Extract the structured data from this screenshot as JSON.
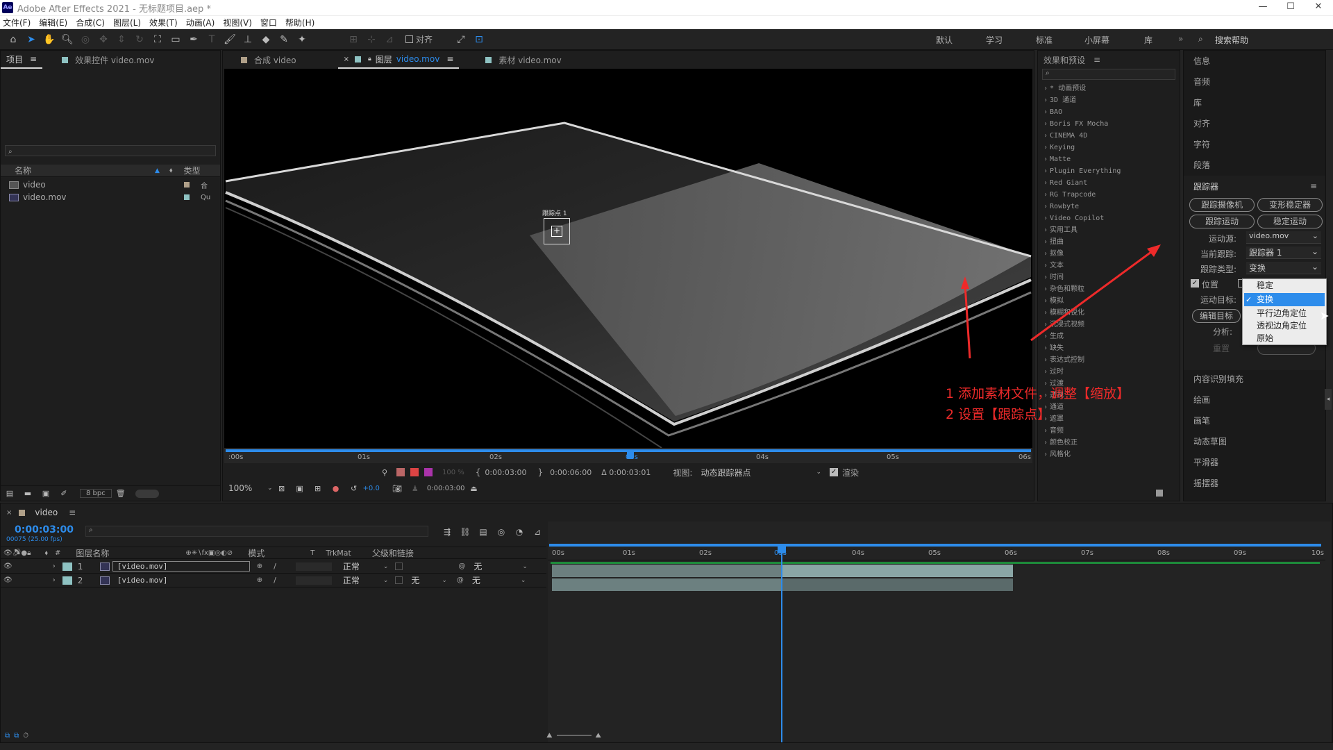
{
  "app": {
    "title": "Adobe After Effects 2021 - 无标题项目.aep *",
    "logo": "Ae",
    "window_controls": [
      "—",
      "☐",
      "✕"
    ]
  },
  "menu": [
    "文件(F)",
    "编辑(E)",
    "合成(C)",
    "图层(L)",
    "效果(T)",
    "动画(A)",
    "视图(V)",
    "窗口",
    "帮助(H)"
  ],
  "toolbar": {
    "snap_label": "对齐",
    "workspaces": [
      "默认",
      "学习",
      "标准",
      "小屏幕",
      "库"
    ],
    "search_help": "搜索帮助"
  },
  "project_panel": {
    "tab_project": "项目",
    "tab_effect_controls": "效果控件 video.mov",
    "col_name": "名称",
    "col_type": "类型",
    "items": [
      {
        "name": "video",
        "type": "合"
      },
      {
        "name": "video.mov",
        "type": "Qu"
      }
    ],
    "bpc": "8 bpc"
  },
  "viewer": {
    "tabs": [
      "合成 video",
      "图层",
      "素材 video.mov"
    ],
    "layer_tab_link": "video.mov",
    "track_point_label": "跟踪点 1",
    "ruler_marks": [
      ":00s",
      "01s",
      "02s",
      "03s",
      "04s",
      "05s",
      "06s"
    ],
    "in_time": "0:00:03:00",
    "out_time": "0:00:06:00",
    "duration": "Δ 0:00:03:01",
    "view_label": "视图:",
    "view_value": "动态跟踪器点",
    "render_label": "渲染",
    "zoom": "100%",
    "exposure": "+0.0",
    "current_time": "0:00:03:00",
    "opacity_pct": "100 %"
  },
  "effects_panel": {
    "title": "效果和预设",
    "items": [
      "* 动画预设",
      "3D 通道",
      "BAO",
      "Boris FX Mocha",
      "CINEMA 4D",
      "Keying",
      "Matte",
      "Plugin Everything",
      "Red Giant",
      "RG Trapcode",
      "Rowbyte",
      "Video Copilot",
      "实用工具",
      "扭曲",
      "抠像",
      "文本",
      "时间",
      "杂色和颗粒",
      "模拟",
      "模糊和锐化",
      "沉浸式视频",
      "生成",
      "缺失",
      "表达式控制",
      "过时",
      "过渡",
      "透视",
      "通道",
      "遮罩",
      "音频",
      "颜色校正",
      "风格化"
    ]
  },
  "right_panel": {
    "items_top": [
      "信息",
      "音频",
      "库",
      "对齐",
      "字符",
      "段落"
    ],
    "tracker_title": "跟踪器",
    "btn_track_camera": "跟踪摄像机",
    "btn_warp_stabilizer": "变形稳定器",
    "btn_track_motion": "跟踪运动",
    "btn_stabilize_motion": "稳定运动",
    "motion_source_label": "运动源:",
    "motion_source_value": "video.mov",
    "current_track_label": "当前跟踪:",
    "current_track_value": "跟踪器 1",
    "track_type_label": "跟踪类型:",
    "track_type_value": "变换",
    "position_label": "位置",
    "motion_target_label": "运动目标:",
    "edit_target_btn": "编辑目标",
    "analyze_label": "分析:",
    "reset_label": "重置",
    "dropdown_options": [
      "稳定",
      "变换",
      "平行边角定位",
      "透视边角定位",
      "原始"
    ],
    "dropdown_selected": "变换",
    "items_bottom": [
      "内容识别填充",
      "绘画",
      "画笔",
      "动态草图",
      "平滑器",
      "摇摆器"
    ]
  },
  "annotation": {
    "line1": "1 添加素材文件，调整【缩放】",
    "line2": "2 设置【跟踪点】"
  },
  "timeline": {
    "comp_name": "video",
    "current_time": "0:00:03:00",
    "frame_info": "00075 (25.00 fps)",
    "col_layer_name": "图层名称",
    "col_mode": "模式",
    "col_t": "T",
    "col_trkmat": "TrkMat",
    "col_parent": "父级和链接",
    "layers": [
      {
        "num": "1",
        "name": "[video.mov]",
        "mode": "正常",
        "trkmat": "",
        "parent": "无"
      },
      {
        "num": "2",
        "name": "[video.mov]",
        "mode": "正常",
        "trkmat": "无",
        "parent": "无"
      }
    ],
    "ruler_marks": [
      "00s",
      "01s",
      "02s",
      "03s",
      "04s",
      "05s",
      "06s",
      "07s",
      "08s",
      "09s",
      "10s"
    ]
  },
  "colors": {
    "accent_blue": "#2d8ceb",
    "annotation_red": "#ee2a2a",
    "label_tan": "#b0a089",
    "label_teal": "#8ec2c2"
  }
}
